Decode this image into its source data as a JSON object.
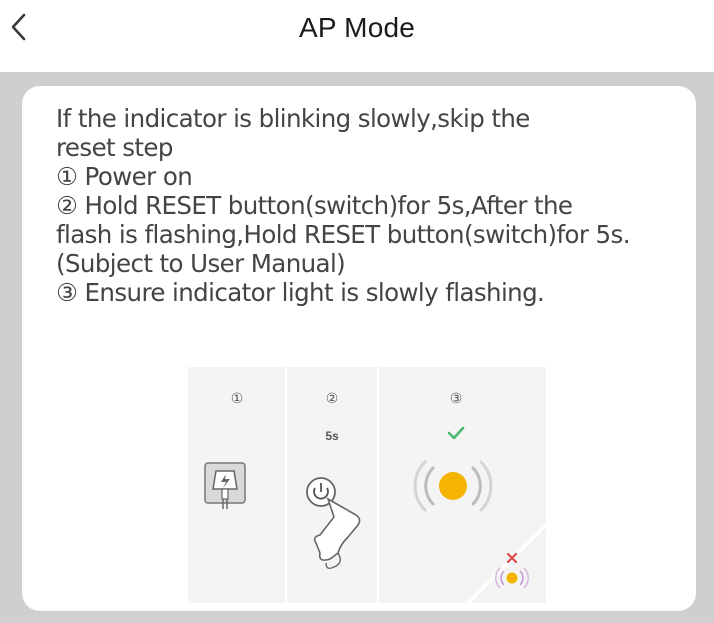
{
  "header": {
    "title": "AP Mode",
    "back_icon": "chevron-left-icon"
  },
  "instructions": {
    "lines": [
      "If the indicator is blinking slowly,skip the",
      "reset step",
      "① Power on",
      "② Hold RESET button(switch)for 5s,After the",
      "flash is flashing,Hold RESET button(switch)for 5s.",
      "(Subject to User Manual)",
      "③ Ensure indicator light is slowly flashing."
    ]
  },
  "illustration": {
    "steps": [
      {
        "number": "①",
        "icon": "power-plug-icon"
      },
      {
        "number": "②",
        "label": "5s",
        "icon": "power-button-press-icon"
      },
      {
        "number": "③",
        "icon": "indicator-flashing-icon",
        "status_icon": "check-icon"
      }
    ],
    "wrong_state_icons": [
      "x-icon",
      "indicator-fast-icon"
    ],
    "colors": {
      "check": "#49b86b",
      "cross": "#e04a4a",
      "indicator": "#f4b400"
    }
  },
  "colors": {
    "panel_bg": "#cfcfcf",
    "card_bg": "#ffffff",
    "text": "#444444",
    "title": "#1b1b1b"
  }
}
